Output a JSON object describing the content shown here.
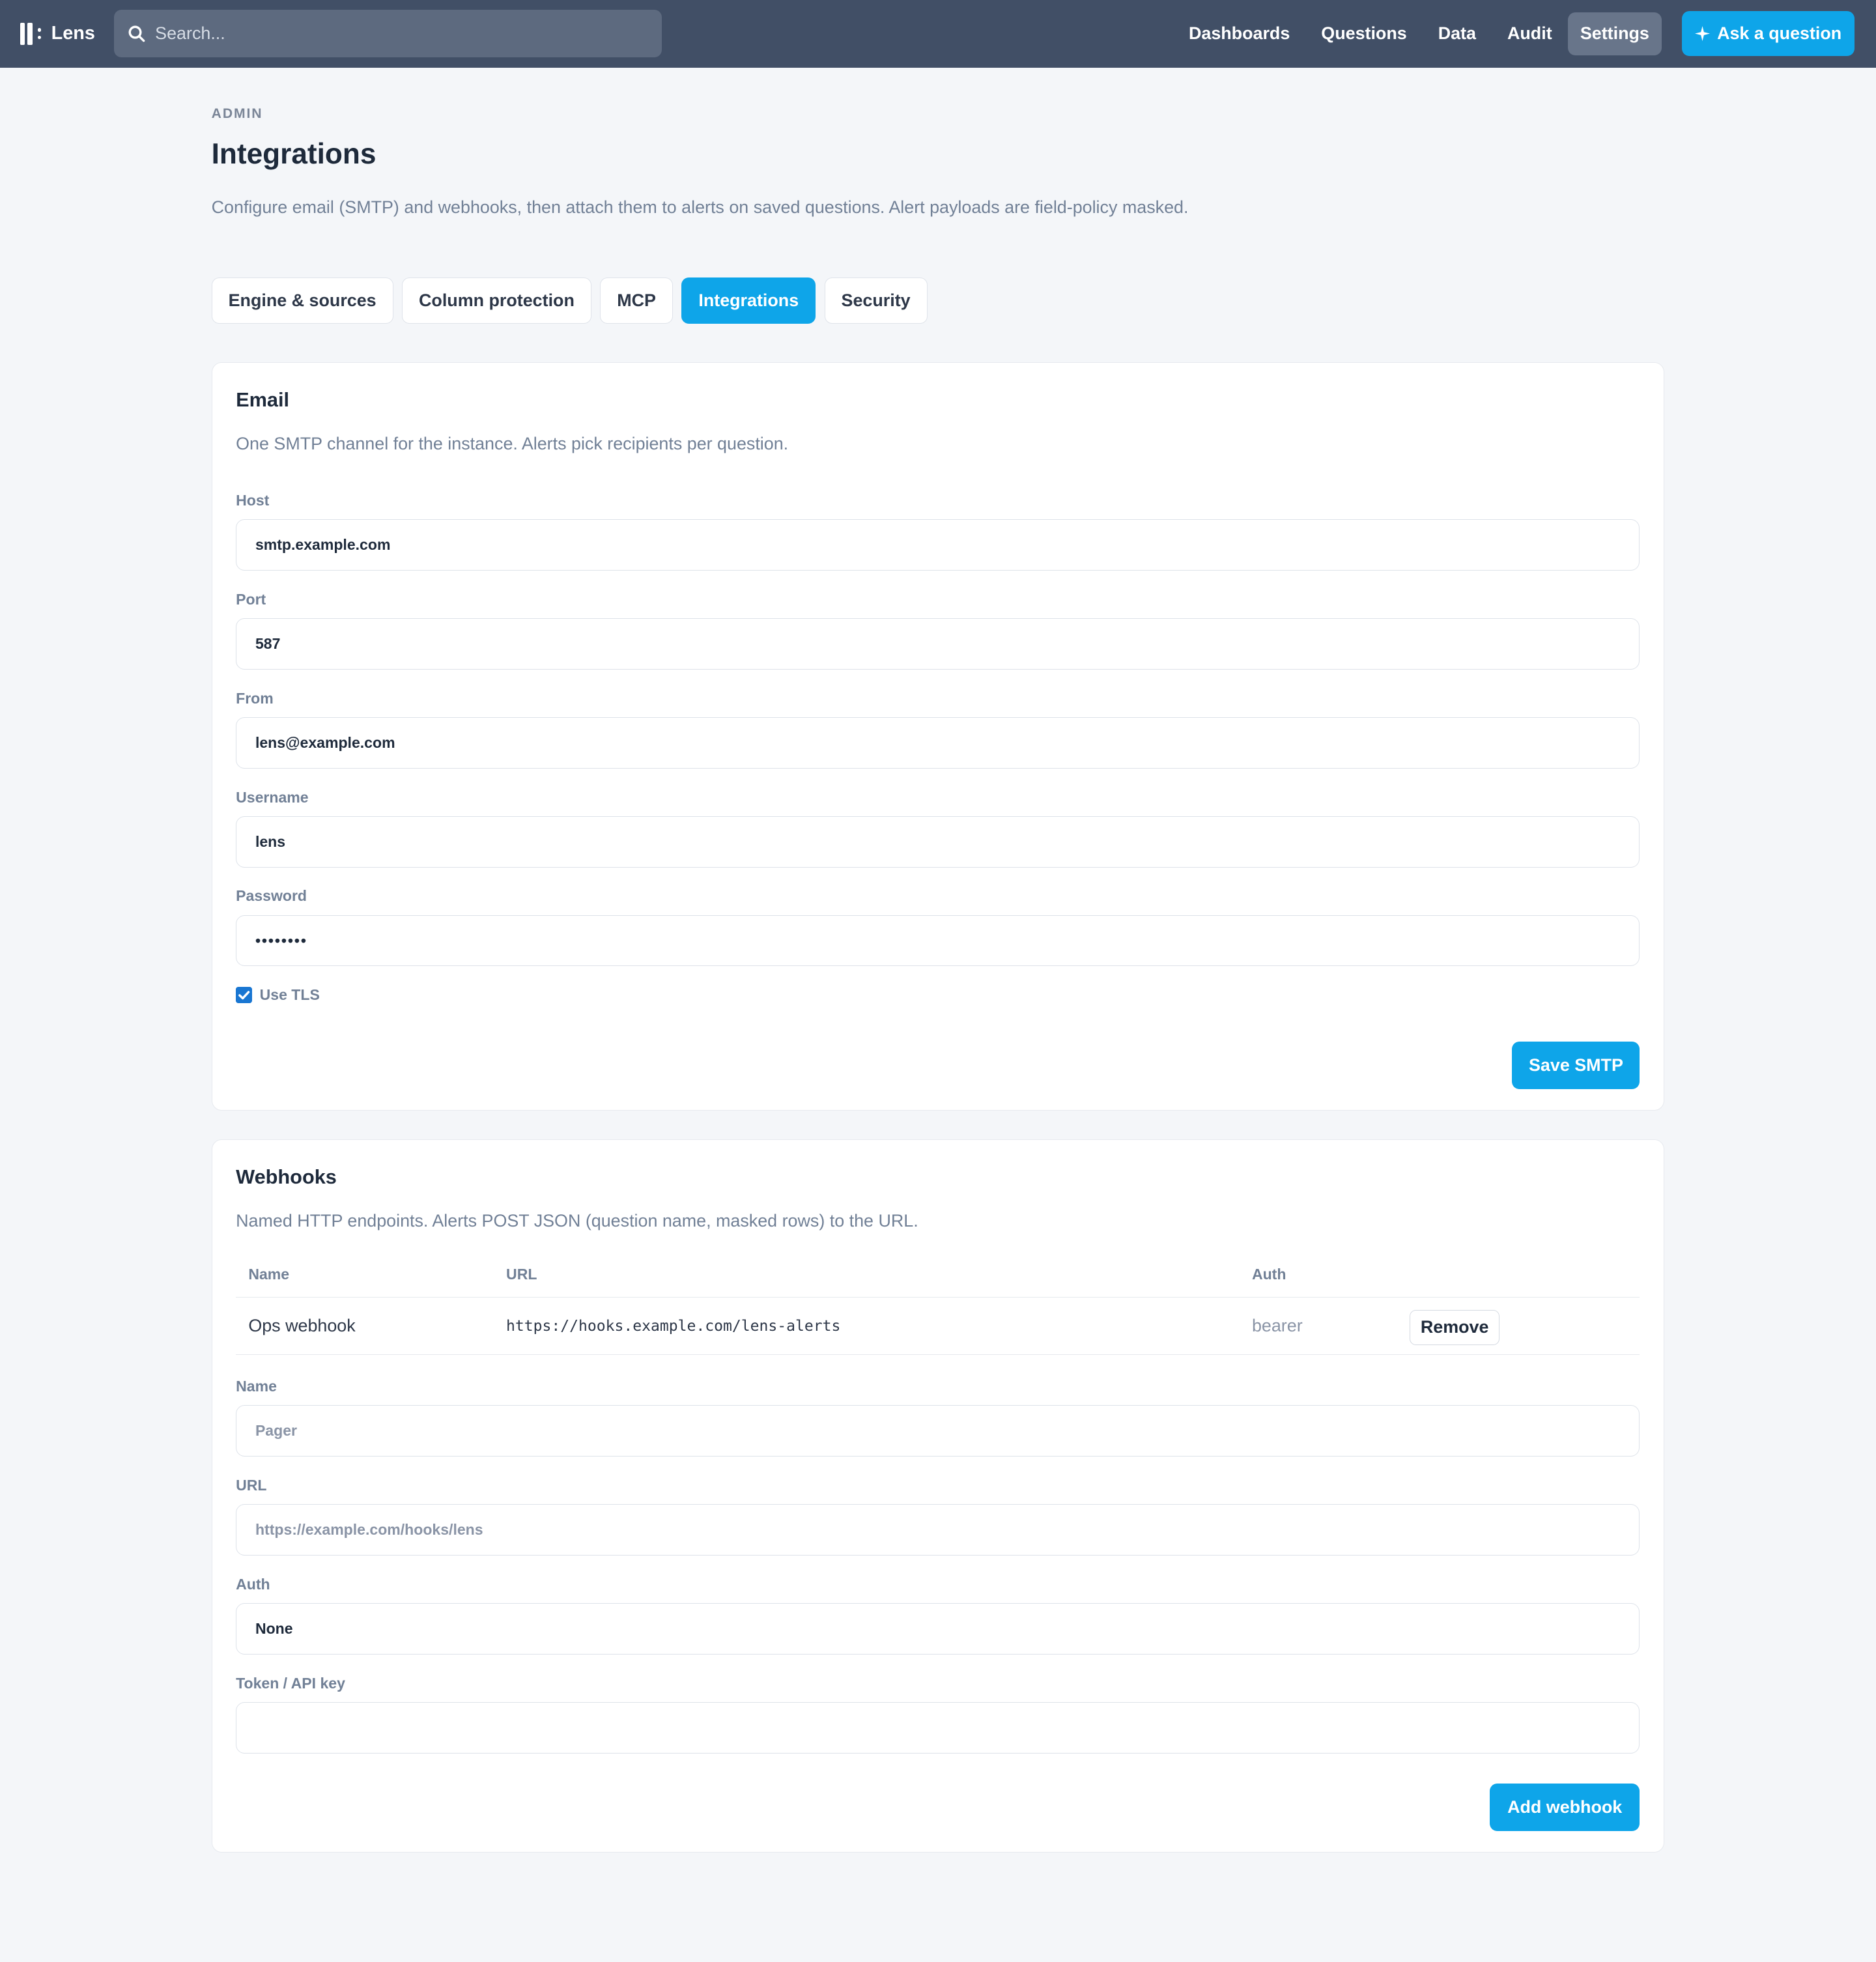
{
  "app": {
    "name": "Lens",
    "search_placeholder": "Search...",
    "nav": [
      {
        "label": "Dashboards"
      },
      {
        "label": "Questions"
      },
      {
        "label": "Data"
      },
      {
        "label": "Audit"
      },
      {
        "label": "Settings"
      }
    ],
    "ask_label": "Ask a question"
  },
  "page": {
    "eyebrow": "ADMIN",
    "title": "Integrations",
    "description": "Configure email (SMTP) and webhooks, then attach them to alerts on saved questions. Alert payloads are field-policy masked."
  },
  "tabs": [
    {
      "label": "Engine & sources"
    },
    {
      "label": "Column protection"
    },
    {
      "label": "MCP"
    },
    {
      "label": "Integrations"
    },
    {
      "label": "Security"
    }
  ],
  "email": {
    "title": "Email",
    "description": "One SMTP channel for the instance. Alerts pick recipients per question.",
    "host_label": "Host",
    "host_value": "smtp.example.com",
    "port_label": "Port",
    "port_value": "587",
    "from_label": "From",
    "from_value": "lens@example.com",
    "username_label": "Username",
    "username_value": "lens",
    "password_label": "Password",
    "password_value": "••••••••",
    "tls_label": "Use TLS",
    "save_label": "Save SMTP"
  },
  "webhooks": {
    "title": "Webhooks",
    "description": "Named HTTP endpoints. Alerts POST JSON (question name, masked rows) to the URL.",
    "columns": {
      "name": "Name",
      "url": "URL",
      "auth": "Auth"
    },
    "rows": [
      {
        "name": "Ops webhook",
        "url": "https://hooks.example.com/lens-alerts",
        "auth": "bearer",
        "action": "Remove"
      }
    ],
    "form": {
      "name_label": "Name",
      "name_placeholder": "Pager",
      "url_label": "URL",
      "url_placeholder": "https://example.com/hooks/lens",
      "auth_label": "Auth",
      "auth_value": "None",
      "token_label": "Token / API key",
      "token_value": ""
    },
    "add_label": "Add webhook"
  }
}
